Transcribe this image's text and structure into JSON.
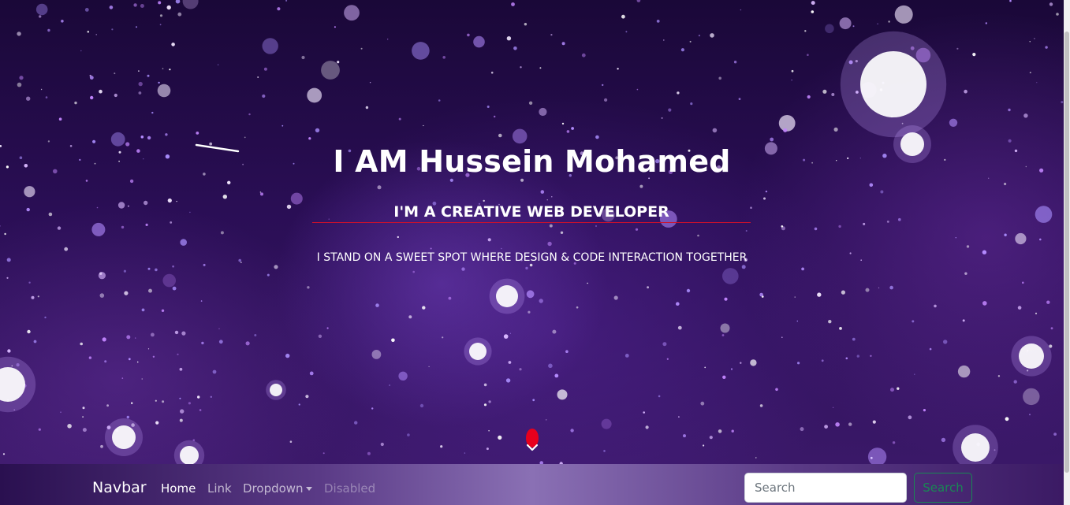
{
  "hero": {
    "title": "I AM Hussein Mohamed",
    "subtitle": "I'M A CREATIVE WEB DEVELOPER",
    "tagline": "I STAND ON A SWEET SPOT WHERE DESIGN & CODE INTERACTION TOGETHER"
  },
  "navbar": {
    "brand": "Navbar",
    "links": {
      "home": "Home",
      "link": "Link",
      "dropdown": "Dropdown",
      "disabled": "Disabled"
    },
    "search": {
      "placeholder": "Search",
      "button_label": "Search"
    }
  },
  "colors": {
    "accent_red": "#e8001c",
    "search_button": "#198754"
  },
  "icons": {
    "scroll_indicator": "chevron-down-icon"
  }
}
